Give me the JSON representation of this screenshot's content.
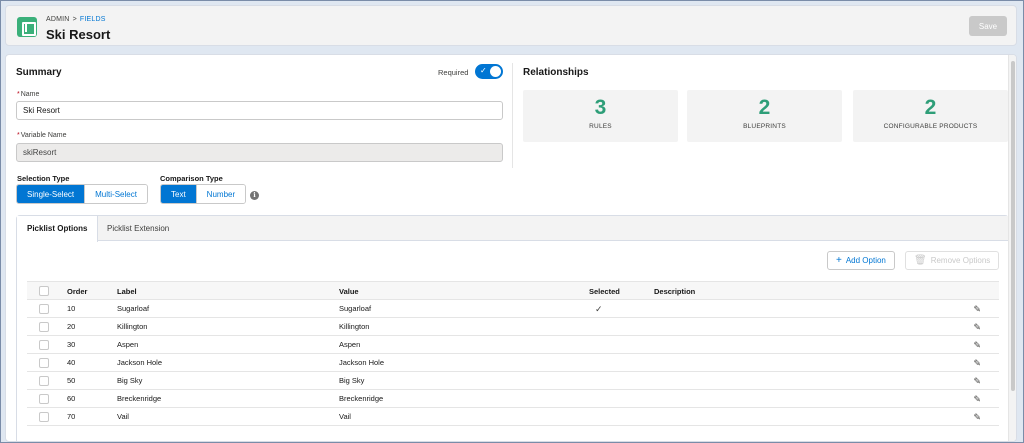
{
  "header": {
    "breadcrumb_admin": "ADMIN",
    "breadcrumb_sep": ">",
    "breadcrumb_fields": "FIELDS",
    "title": "Ski Resort",
    "save_label": "Save",
    "icon": "app-field-icon"
  },
  "summary": {
    "title": "Summary",
    "required_label": "Required",
    "required_on": true,
    "name_label": "Name",
    "name_value": "Ski Resort",
    "variable_label": "Variable Name",
    "variable_value": "skiResort",
    "selection_type_label": "Selection Type",
    "selection_options": [
      "Single-Select",
      "Multi-Select"
    ],
    "selection_active": "Single-Select",
    "comparison_type_label": "Comparison Type",
    "comparison_options": [
      "Text",
      "Number"
    ],
    "comparison_active": "Text",
    "info_icon": "info-icon"
  },
  "relationships": {
    "title": "Relationships",
    "stats": [
      {
        "value": "3",
        "label": "RULES"
      },
      {
        "value": "2",
        "label": "BLUEPRINTS"
      },
      {
        "value": "2",
        "label": "CONFIGURABLE PRODUCTS"
      }
    ]
  },
  "tabs": [
    {
      "label": "Picklist Options",
      "active": true
    },
    {
      "label": "Picklist Extension",
      "active": false
    }
  ],
  "actions": {
    "add_label": "Add Option",
    "remove_label": "Remove Options"
  },
  "table": {
    "columns": [
      "Order",
      "Label",
      "Value",
      "Selected",
      "Description"
    ],
    "rows": [
      {
        "order": "10",
        "label": "Sugarloaf",
        "value": "Sugarloaf",
        "selected": true,
        "description": ""
      },
      {
        "order": "20",
        "label": "Killington",
        "value": "Killington",
        "selected": false,
        "description": ""
      },
      {
        "order": "30",
        "label": "Aspen",
        "value": "Aspen",
        "selected": false,
        "description": ""
      },
      {
        "order": "40",
        "label": "Jackson Hole",
        "value": "Jackson Hole",
        "selected": false,
        "description": ""
      },
      {
        "order": "50",
        "label": "Big Sky",
        "value": "Big Sky",
        "selected": false,
        "description": ""
      },
      {
        "order": "60",
        "label": "Breckenridge",
        "value": "Breckenridge",
        "selected": false,
        "description": ""
      },
      {
        "order": "70",
        "label": "Vail",
        "value": "Vail",
        "selected": false,
        "description": ""
      }
    ]
  },
  "colors": {
    "accent": "#0176d3",
    "stat_number": "#2e9e78",
    "app_icon": "#3bb07a"
  }
}
